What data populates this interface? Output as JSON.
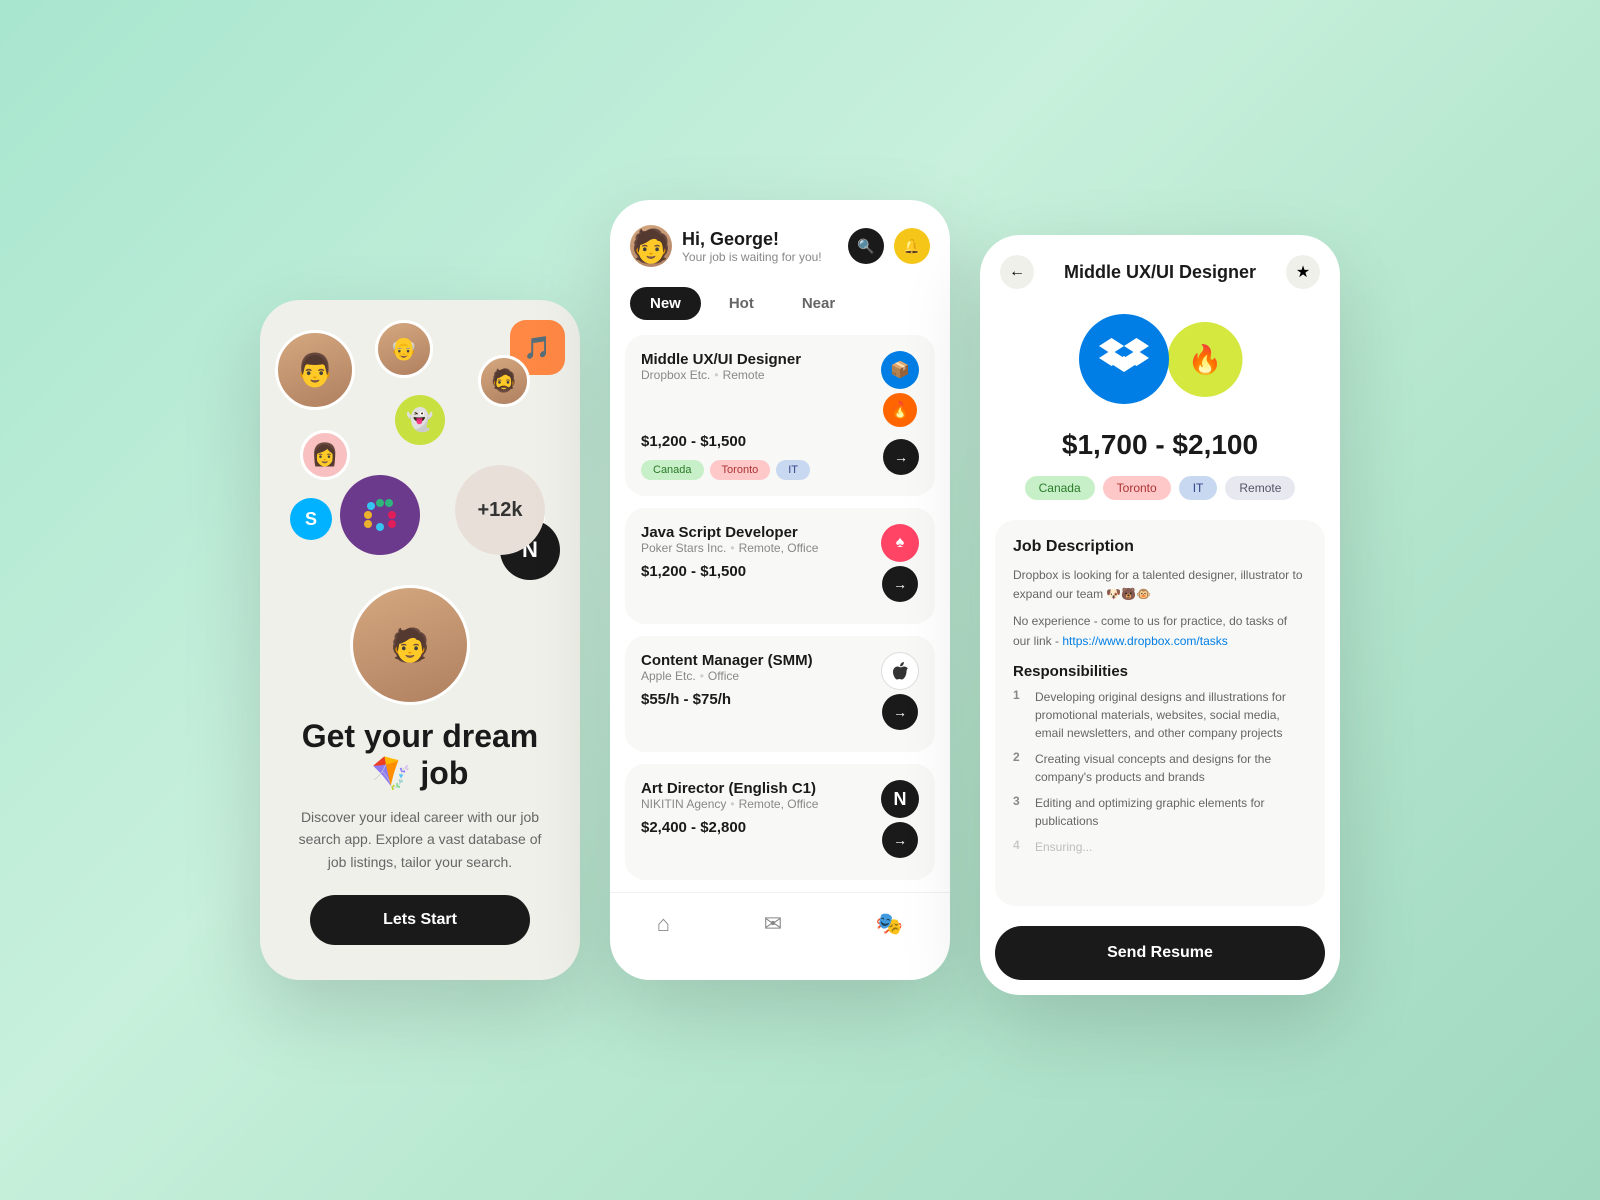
{
  "background": "#a8e6cf",
  "phone1": {
    "hero_title": "Get your dream 🪁 job",
    "hero_subtitle": "Discover your ideal career with our job search app. Explore a vast database of job listings, tailor your search.",
    "start_button": "Lets Start",
    "plus_count": "+12k"
  },
  "phone2": {
    "greeting": "Hi, George!",
    "tagline": "Your job is waiting for you!",
    "filters": [
      "New",
      "Hot",
      "Near"
    ],
    "active_filter": "New",
    "jobs": [
      {
        "title": "Middle UX/UI Designer",
        "company": "Dropbox Etc.",
        "location": "Remote",
        "salary": "$1,200 - $1,500",
        "tags": [
          "Canada",
          "Toronto",
          "IT"
        ],
        "tag_styles": [
          "green",
          "pink",
          "blue"
        ]
      },
      {
        "title": "Java Script Developer",
        "company": "Poker Stars Inc.",
        "location": "Remote, Office",
        "salary": "$1,200 - $1,500",
        "tags": [],
        "tag_styles": []
      },
      {
        "title": "Content Manager (SMM)",
        "company": "Apple Etc.",
        "location": "Office",
        "salary": "$55/h - $75/h",
        "tags": [],
        "tag_styles": []
      },
      {
        "title": "Art Director (English C1)",
        "company": "NIKITIN Agency",
        "location": "Remote, Office",
        "salary": "$2,400 - $2,800",
        "tags": [],
        "tag_styles": []
      }
    ]
  },
  "phone3": {
    "job_title": "Middle UX/UI Designer",
    "salary": "$1,700 - $2,100",
    "tags": [
      "Canada",
      "Toronto",
      "IT",
      "Remote"
    ],
    "tag_styles": [
      "green",
      "pink",
      "blue",
      "light"
    ],
    "description_title": "Job Description",
    "description_text1": "Dropbox is looking for a talented designer, illustrator to expand our team 🐶🐻🐵",
    "description_text2": "No experience - come to us for practice, do tasks of our link - https://www.dropbox.com/tasks",
    "responsibilities_title": "Responsibilities",
    "responsibilities": [
      "Developing original designs and illustrations for promotional materials, websites, social media, email newsletters, and other company projects",
      "Creating visual concepts and designs for the company's products and brands",
      "Editing and optimizing graphic elements for publications",
      "Ensuring..."
    ],
    "send_button": "Send Resume"
  }
}
